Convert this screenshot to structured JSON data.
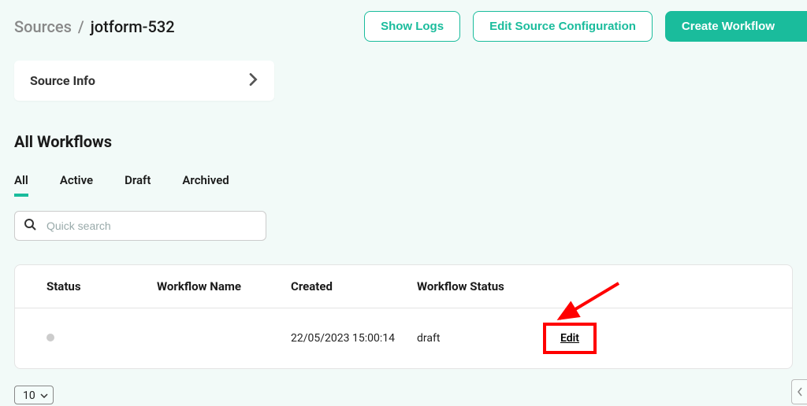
{
  "header": {
    "breadcrumb_root": "Sources",
    "breadcrumb_sep": "/",
    "breadcrumb_current": "jotform-532",
    "actions": {
      "show_logs": "Show Logs",
      "edit_config": "Edit Source Configuration",
      "create_workflow": "Create Workflow"
    }
  },
  "source_info": {
    "title": "Source Info"
  },
  "workflows": {
    "title": "All Workflows",
    "tabs": [
      "All",
      "Active",
      "Draft",
      "Archived"
    ],
    "active_tab_index": 0,
    "search_placeholder": "Quick search",
    "columns": {
      "status": "Status",
      "name": "Workflow Name",
      "created": "Created",
      "workflow_status": "Workflow Status"
    },
    "rows": [
      {
        "status_color": "#ccc",
        "name": "",
        "created": "22/05/2023 15:00:14",
        "workflow_status": "draft",
        "action_label": "Edit"
      }
    ]
  },
  "pager": {
    "size": "10"
  }
}
